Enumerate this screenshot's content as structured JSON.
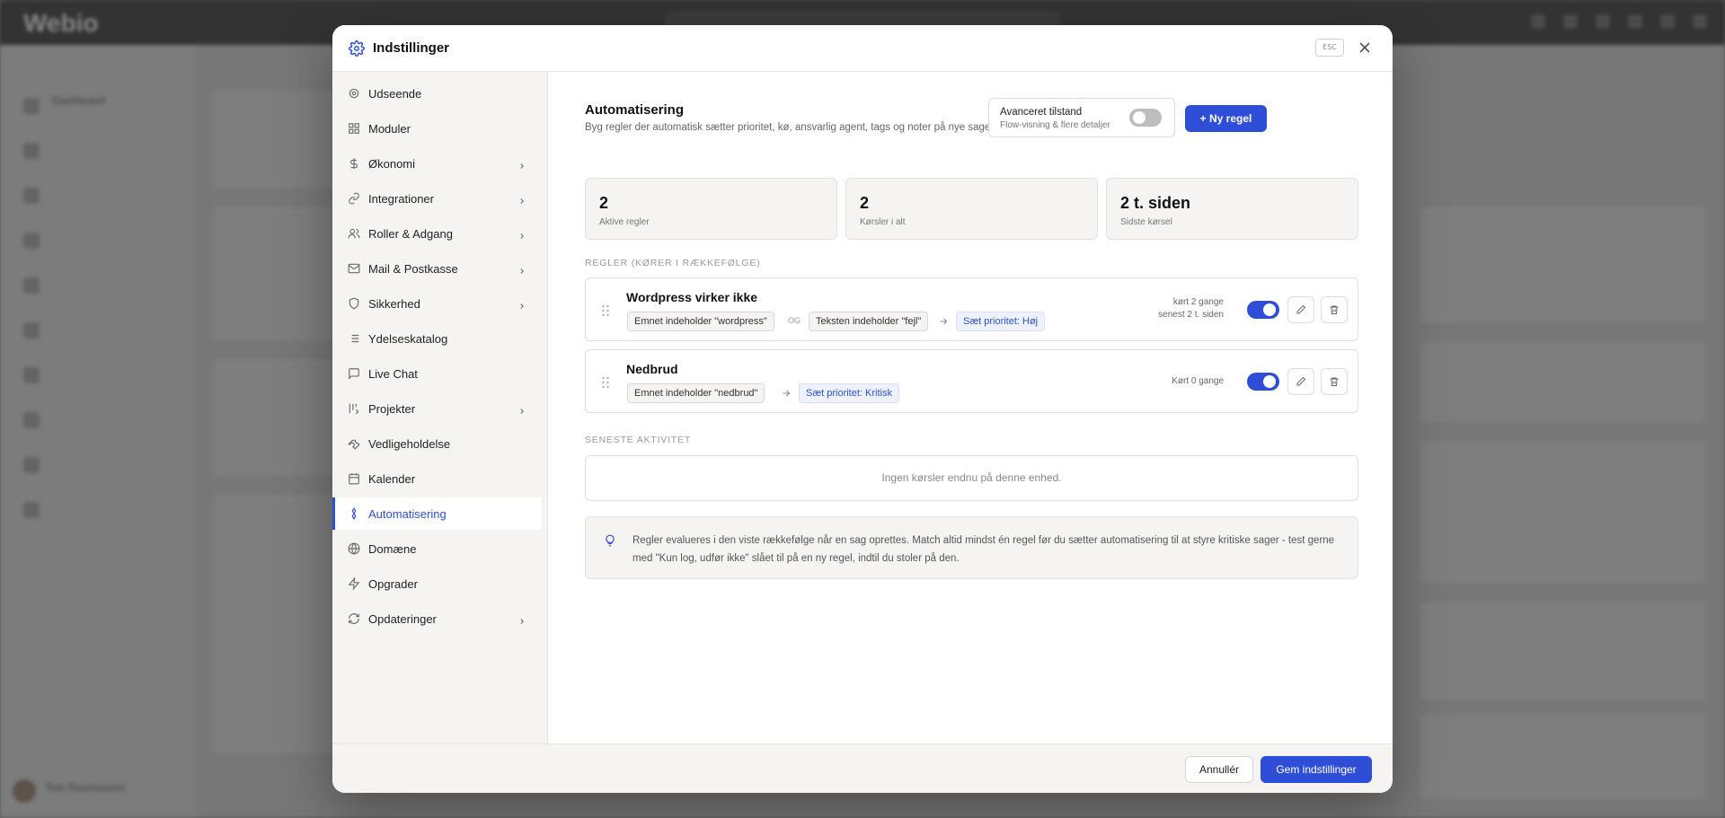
{
  "background": {
    "logo": "Webio",
    "user_name": "Tom Rasmussen"
  },
  "modal": {
    "title": "Indstillinger",
    "esc_label": "ESC",
    "nav": [
      {
        "label": "Udseende",
        "icon": "gear-icon",
        "chevron": false
      },
      {
        "label": "Moduler",
        "icon": "grid-icon",
        "chevron": false
      },
      {
        "label": "Økonomi",
        "icon": "dollar-icon",
        "chevron": true
      },
      {
        "label": "Integrationer",
        "icon": "link-icon",
        "chevron": true
      },
      {
        "label": "Roller & Adgang",
        "icon": "users-icon",
        "chevron": true
      },
      {
        "label": "Mail & Postkasse",
        "icon": "mail-icon",
        "chevron": true
      },
      {
        "label": "Sikkerhed",
        "icon": "shield-icon",
        "chevron": true
      },
      {
        "label": "Ydelseskatalog",
        "icon": "list-icon",
        "chevron": false
      },
      {
        "label": "Live Chat",
        "icon": "chat-icon",
        "chevron": false
      },
      {
        "label": "Projekter",
        "icon": "kanban-icon",
        "chevron": true
      },
      {
        "label": "Vedligeholdelse",
        "icon": "wrench-icon",
        "chevron": false
      },
      {
        "label": "Kalender",
        "icon": "calendar-icon",
        "chevron": false
      },
      {
        "label": "Automatisering",
        "icon": "automation-icon",
        "chevron": false,
        "active": true
      },
      {
        "label": "Domæne",
        "icon": "globe-icon",
        "chevron": false
      },
      {
        "label": "Opgrader",
        "icon": "bolt-icon",
        "chevron": false
      },
      {
        "label": "Opdateringer",
        "icon": "refresh-icon",
        "chevron": true
      }
    ]
  },
  "content": {
    "title": "Automatisering",
    "subtitle": "Byg regler der automatisk sætter prioritet, kø, ansvarlig agent, tags og noter på nye sager",
    "advanced": {
      "label": "Avanceret tilstand",
      "sub": "Flow-visning & flere detaljer",
      "enabled": false
    },
    "new_rule_label": "+ Ny regel",
    "stats": [
      {
        "value": "2",
        "label": "Aktive regler"
      },
      {
        "value": "2",
        "label": "Kørsler i alt"
      },
      {
        "value": "2 t. siden",
        "label": "Sidste kørsel"
      }
    ],
    "rules_heading": "REGLER (KØRER I RÆKKEFØLGE)",
    "rules": [
      {
        "name": "Wordpress virker ikke",
        "conditions": [
          "Emnet indeholder \"wordpress\"",
          "Teksten indeholder \"fejl\""
        ],
        "joiner": "OG",
        "action": "Sæt prioritet: Høj",
        "run_line1": "kørt 2 gange",
        "run_line2": "senest 2 t. siden",
        "enabled": true
      },
      {
        "name": "Nedbrud",
        "conditions": [
          "Emnet indeholder \"nedbrud\""
        ],
        "action": "Sæt prioritet: Kritisk",
        "run_line1": "Kørt 0 gange",
        "enabled": true
      }
    ],
    "activity_heading": "SENESTE AKTIVITET",
    "activity_empty": "Ingen kørsler endnu på denne enhed.",
    "info_text": "Regler evalueres i den viste rækkefølge når en sag oprettes. Match altid mindst én regel før du sætter automatisering til at styre kritiske sager - test gerne med \"Kun log, udfør ikke\" slået til på en ny regel, indtil du stoler på den."
  },
  "footer": {
    "cancel_label": "Annullér",
    "save_label": "Gem indstillinger"
  },
  "colors": {
    "accent": "#2f4ed8",
    "toggle_off": "#bdbdbd"
  }
}
